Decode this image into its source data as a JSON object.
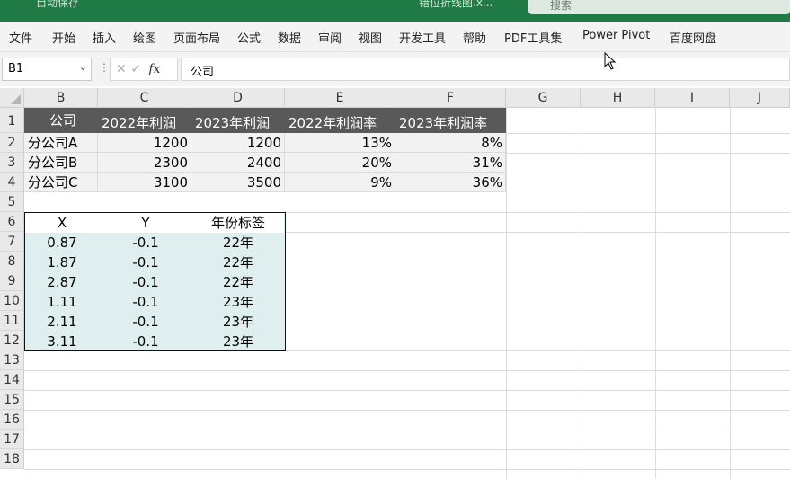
{
  "titlebar": {
    "autosave": "自动保存",
    "filename": "错位折线图.x...",
    "search": "搜索"
  },
  "ribbon": {
    "tabs": [
      "文件",
      "开始",
      "插入",
      "绘图",
      "页面布局",
      "公式",
      "数据",
      "审阅",
      "视图",
      "开发工具",
      "帮助",
      "PDF工具集",
      "Power Pivot",
      "百度网盘"
    ]
  },
  "formula_bar": {
    "name_box": "B1",
    "formula": "公司"
  },
  "columns": [
    "B",
    "C",
    "D",
    "E",
    "F",
    "G",
    "H",
    "I",
    "J"
  ],
  "rows": [
    "1",
    "2",
    "3",
    "4",
    "5",
    "6",
    "7",
    "8",
    "9",
    "10",
    "11",
    "12",
    "13",
    "14",
    "15",
    "16",
    "17",
    "18"
  ],
  "table1": {
    "headers": [
      "公司",
      "2022年利润",
      "2023年利润",
      "2022年利润率",
      "2023年利润率"
    ],
    "rows": [
      [
        "分公司A",
        "1200",
        "1200",
        "13%",
        "8%"
      ],
      [
        "分公司B",
        "2300",
        "2400",
        "20%",
        "31%"
      ],
      [
        "分公司C",
        "3100",
        "3500",
        "9%",
        "36%"
      ]
    ]
  },
  "table2": {
    "headers": [
      "X",
      "Y",
      "年份标签"
    ],
    "rows": [
      [
        "0.87",
        "-0.1",
        "22年"
      ],
      [
        "1.87",
        "-0.1",
        "22年"
      ],
      [
        "2.87",
        "-0.1",
        "22年"
      ],
      [
        "1.11",
        "-0.1",
        "23年"
      ],
      [
        "2.11",
        "-0.1",
        "23年"
      ],
      [
        "3.11",
        "-0.1",
        "23年"
      ]
    ]
  }
}
